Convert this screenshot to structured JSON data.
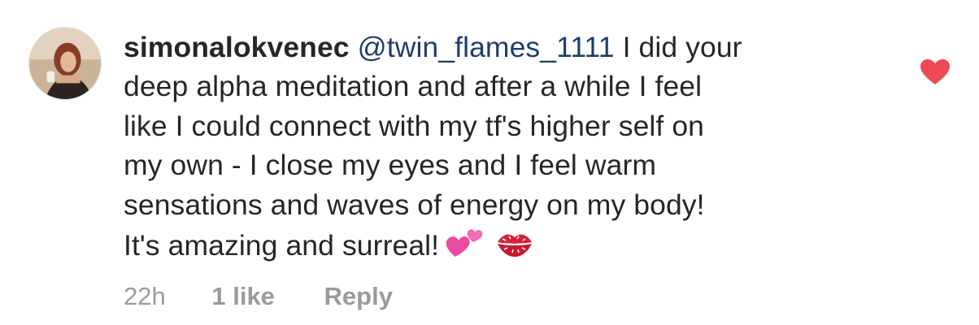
{
  "comment": {
    "username": "simonalokvenec",
    "mention": "@twin_flames_1111",
    "lines": [
      "I did your",
      "deep alpha meditation and after a while I feel",
      "like I could connect with my tf's higher self on",
      "my own - I close my eyes and I feel warm",
      "sensations and waves of energy on my body!",
      "It's amazing and surreal!"
    ],
    "emojis": [
      "two-hearts",
      "kiss-mark"
    ],
    "liked": true,
    "like_color": "#ed4956"
  },
  "meta": {
    "time": "22h",
    "likes": "1 like",
    "reply": "Reply"
  }
}
